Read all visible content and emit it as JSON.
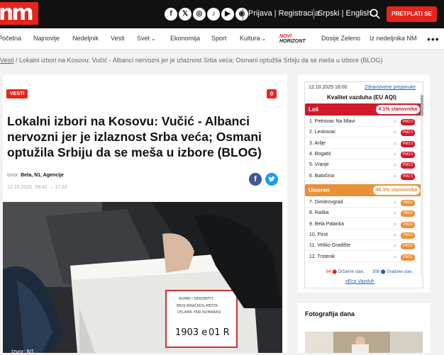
{
  "header": {
    "logo_text": "nm",
    "socials": [
      {
        "icon": "facebook-icon",
        "glyph": "f"
      },
      {
        "icon": "x-icon",
        "glyph": "𝕏"
      },
      {
        "icon": "instagram-icon",
        "glyph": "◎"
      },
      {
        "icon": "tiktok-icon",
        "glyph": "♪"
      },
      {
        "icon": "youtube-icon",
        "glyph": "▶"
      },
      {
        "icon": "podcast-icon",
        "glyph": "◉"
      }
    ],
    "login_label": "Prijava | Registracija",
    "language_label": "Srpski | English",
    "subscribe_label": "PRETPLATI SE"
  },
  "nav": {
    "items": [
      "Početna",
      "Najnovije",
      "Nedeljnik",
      "Vesti",
      "Svet",
      "Ekonomija",
      "Sport",
      "Kultura",
      "Dosije Zeleno",
      "Iz nedeljnika NM"
    ],
    "horizont_n": "NOVI",
    "horizont_label": "HORIZONT",
    "more_label": "•••"
  },
  "breadcrumb": {
    "first": "Vesti",
    "rest": " / Lokalni izbori na Kosovu: Vučić - Albanci nervozni jer je izlaznost Srba veća; Osmani optužila Srbiju da se meša u izbore (BLOG)"
  },
  "article": {
    "tag": "VESTI",
    "comments_count": "0",
    "title": "Lokalni izbori na Kosovu: Vučić - Albanci nervozni jer je izlaznost Srba veća; Osmani optužila Srbiju da se meša u izbore (BLOG)",
    "source_prefix": "Izvor: ",
    "source": "Beta, N1, Agencije",
    "date": "12.10.2025. 09:42 → 17:33",
    "caption": "Izvor: N1",
    "ballot_number": "1903 e",
    "ballot_code": "01 R"
  },
  "air_quality": {
    "date": "12.10.2025 18:00",
    "recommendation_link": "Zdravstvene preporuke",
    "title": "Kvalitet vazduha (EU AQI)",
    "bands": [
      {
        "label": "Loš",
        "percent": "4.1% stanovnika",
        "color": "#d1192b"
      },
      {
        "label": "Umeren",
        "percent": "46.3% stanovnika",
        "color": "#e8913a"
      }
    ],
    "cities_bad": [
      "1. Petrovac Na Mlavi",
      "2. Leskovac",
      "3. Arilje",
      "4. Bogatić",
      "5. Vranje",
      "6. Batočina"
    ],
    "cities_moderate": [
      "7. Dimitrovgrad",
      "8. Raška",
      "9. Bela Palanka",
      "10. Pirot",
      "11. Veliko Gradište",
      "12. Trstenik"
    ],
    "pill_bad": "PM2.5",
    "pill_moderate": "PM10",
    "state_count": "84",
    "state_label": "Državne stan.",
    "city_count": "308",
    "city_label": "Gradske stan.",
    "brand": "xEco Vazduh"
  },
  "photo_of_day": {
    "title": "Fotografija dana"
  }
}
